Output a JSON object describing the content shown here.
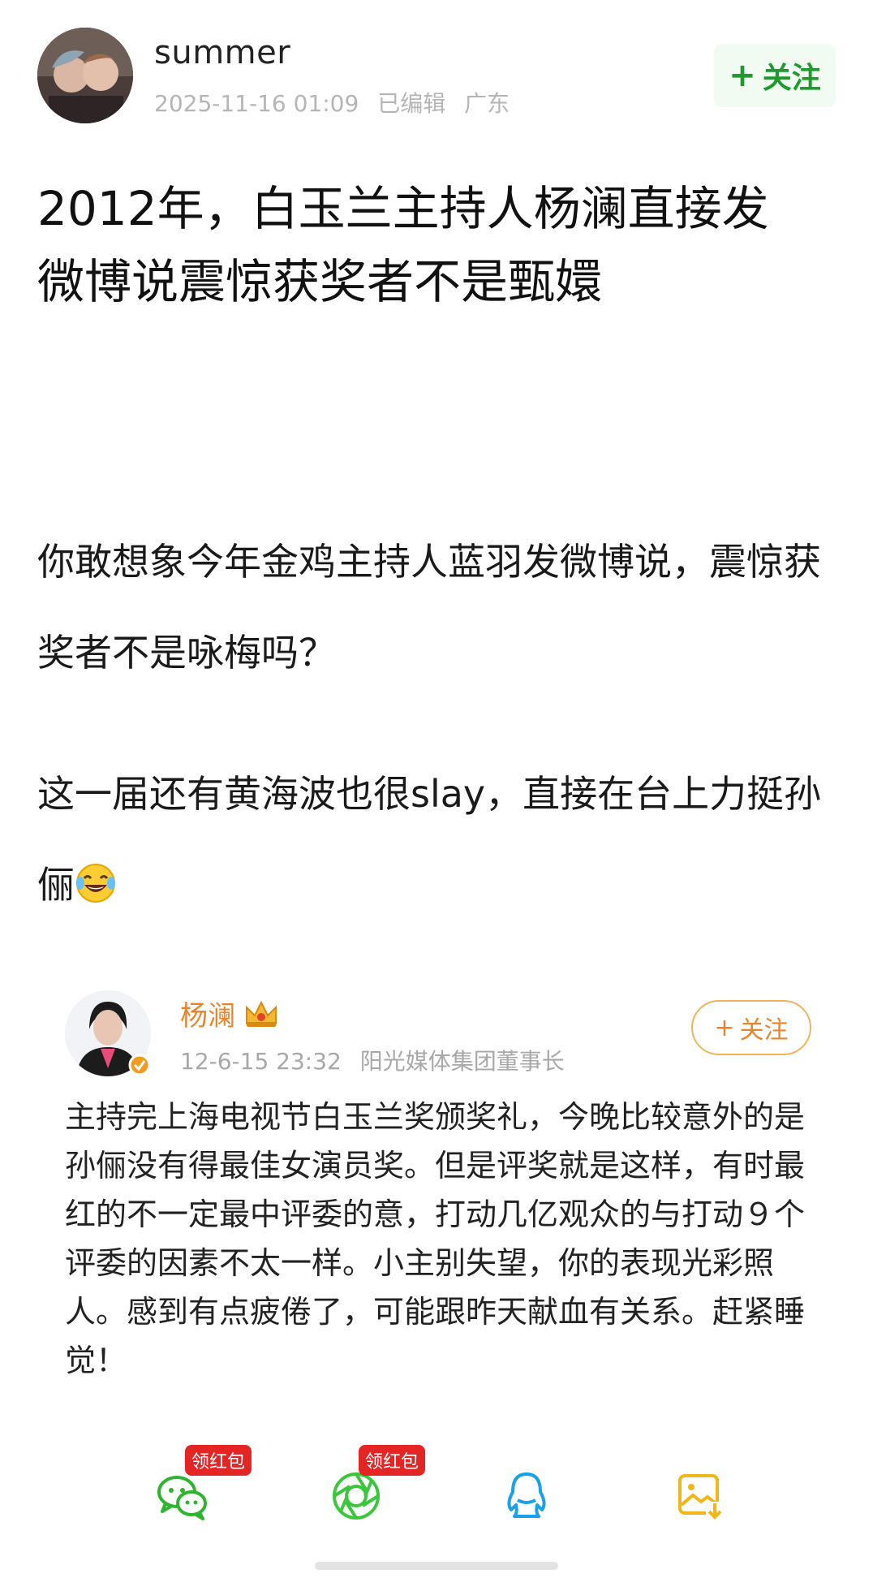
{
  "author": {
    "name": "summer",
    "timestamp": "2025-11-16 01:09",
    "edited": "已编辑",
    "location": "广东",
    "follow_label": "关注",
    "follow_prefix": "+"
  },
  "post": {
    "title_line1": "2012年，白玉兰主持人杨澜直接发",
    "title_line2": "微博说震惊获奖者不是甄嬛",
    "para1": "你敢想象今年金鸡主持人蓝羽发微博说，震惊获奖者不是咏梅吗？",
    "para2": "这一届还有黄海波也很slay，直接在台上力挺孙俪",
    "emoji": "laughing-crying"
  },
  "embedded": {
    "name": "杨澜",
    "timestamp": "12-6-15 23:32",
    "title": "阳光媒体集团董事长",
    "follow_label": "关注",
    "follow_prefix": "+",
    "text": "主持完上海电视节白玉兰奖颁奖礼，今晚比较意外的是孙俪没有得最佳女演员奖。但是评奖就是这样，有时最红的不一定最中评委的意，打动几亿观众的与打动９个评委的因素不太一样。小主别失望，你的表现光彩照人。感到有点疲倦了，可能跟昨天献血有关系。赶紧睡觉！"
  },
  "share_bar": {
    "items": [
      {
        "name": "wechat",
        "badge": "领红包",
        "color": "#2eb42e"
      },
      {
        "name": "moments",
        "badge": "领红包",
        "color": "#3cc63c"
      },
      {
        "name": "qq",
        "badge": "",
        "color": "#1aa2e8"
      },
      {
        "name": "save-image",
        "badge": "",
        "color": "#f2b618"
      }
    ]
  },
  "colors": {
    "follow_green": "#1e9a2e",
    "embed_orange": "#e8852a",
    "meta_gray": "#b5b5b5",
    "badge_red": "#e52424"
  }
}
